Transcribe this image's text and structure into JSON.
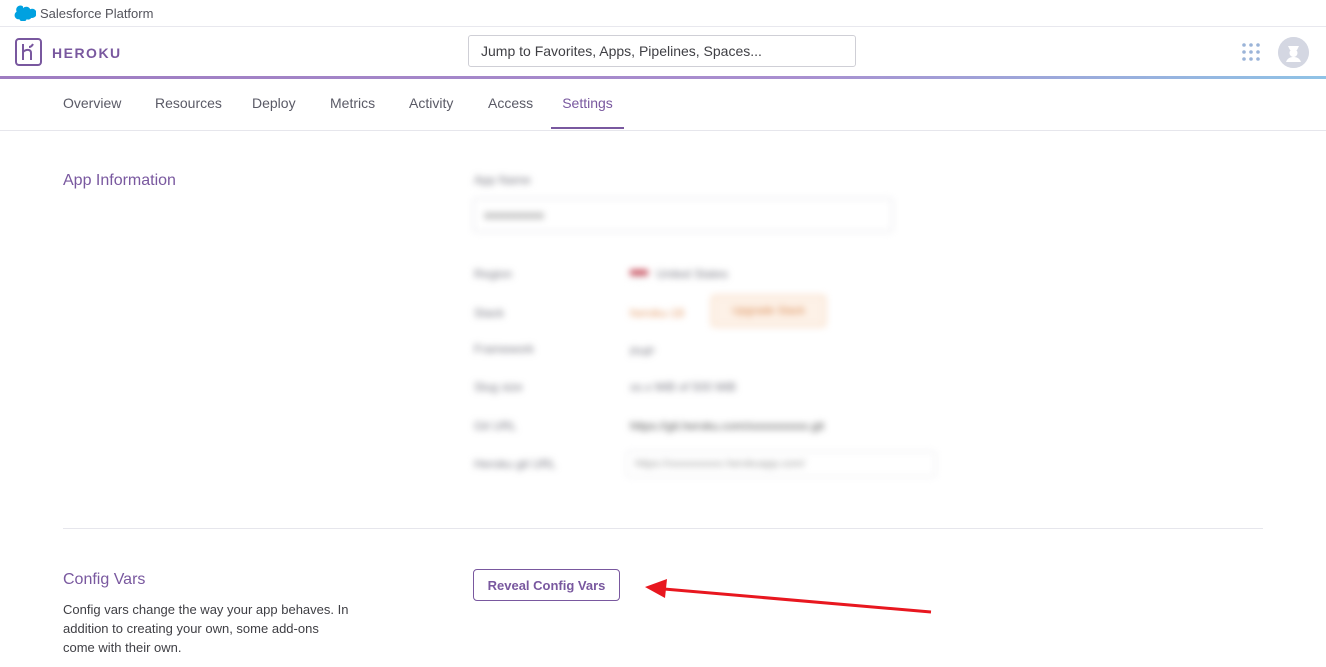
{
  "platform_bar": {
    "label": "Salesforce Platform"
  },
  "header": {
    "wordmark": "HEROKU",
    "search_placeholder": "Jump to Favorites, Apps, Pipelines, Spaces...",
    "apps_icon": "apps-grid-icon",
    "avatar_icon": "user-avatar-icon"
  },
  "tabs": [
    {
      "label": "Overview"
    },
    {
      "label": "Resources"
    },
    {
      "label": "Deploy"
    },
    {
      "label": "Metrics"
    },
    {
      "label": "Activity"
    },
    {
      "label": "Access"
    },
    {
      "label": "Settings",
      "active": true
    }
  ],
  "app_info": {
    "title": "App Information",
    "blurred": {
      "name_label": "App Name",
      "name_value": "xxxxxxxxxx",
      "rows": [
        {
          "label": "Region",
          "value": "United States"
        },
        {
          "label": "Stack",
          "value": "heroku-18",
          "badge": "Upgrade Stack"
        },
        {
          "label": "Framework",
          "value": "PHP"
        },
        {
          "label": "Slug size",
          "value": "xx.x MiB of 500 MiB"
        },
        {
          "label": "Git URL",
          "value": "https://git.heroku.com/xxxxxxxxxx.git"
        },
        {
          "label": "Heroku git URL",
          "value": "https://xxxxxxxxxx.herokuapp.com/"
        }
      ]
    }
  },
  "config_vars": {
    "title": "Config Vars",
    "description": "Config vars change the way your app behaves. In addition to creating your own, some add-ons come with their own.",
    "reveal_button": "Reveal Config Vars"
  },
  "colors": {
    "brand": "#79589f",
    "annotation_arrow": "#e8171f",
    "salesforce_blue": "#00a1e0"
  }
}
